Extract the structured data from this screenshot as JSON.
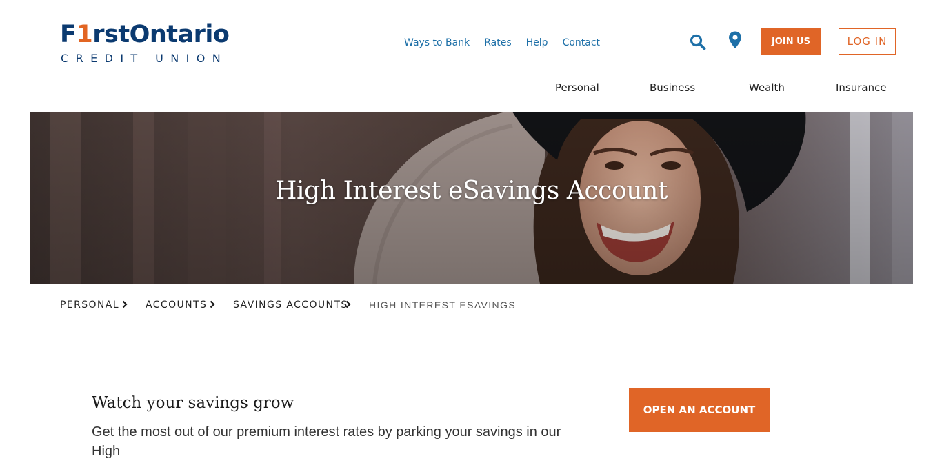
{
  "brand": {
    "logo_main_pre": "F",
    "logo_main_one": "1",
    "logo_main_post": "rstOntario",
    "logo_sub": "CREDIT UNION",
    "accent_color": "#e06527",
    "primary_color": "#0b3a70",
    "link_color": "#1e70a8"
  },
  "utility_nav": [
    "Ways to Bank",
    "Rates",
    "Help",
    "Contact"
  ],
  "header_icons": {
    "search": "search-icon",
    "location": "map-pin-icon"
  },
  "header_buttons": {
    "join": "JOIN US",
    "login": "LOG IN"
  },
  "main_nav": [
    "Personal",
    "Business",
    "Wealth",
    "Insurance"
  ],
  "hero": {
    "title": "High Interest eSavings Account"
  },
  "breadcrumb": {
    "items": [
      "PERSONAL",
      "ACCOUNTS",
      "SAVINGS ACCOUNTS"
    ],
    "current": "HIGH INTEREST ESAVINGS"
  },
  "content": {
    "heading": "Watch your savings grow",
    "body": "Get the most out of our premium interest rates by parking your savings in our High"
  },
  "cta": {
    "open_account": "OPEN AN ACCOUNT"
  }
}
